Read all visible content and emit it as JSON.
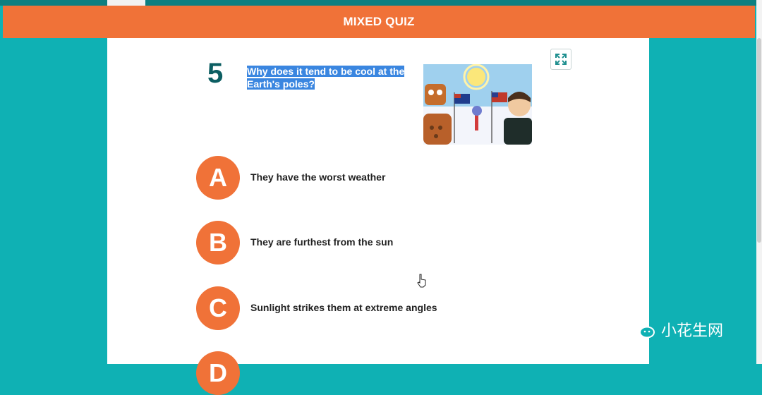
{
  "header": {
    "title": "MIXED QUIZ"
  },
  "question": {
    "number": "5",
    "text": "Why does it tend to be cool at the Earth's poles?"
  },
  "options": [
    {
      "letter": "A",
      "text": "They have the worst weather"
    },
    {
      "letter": "B",
      "text": "They are furthest from the sun"
    },
    {
      "letter": "C",
      "text": "Sunlight strikes them at extreme angles"
    },
    {
      "letter": "D",
      "text": ""
    }
  ],
  "icons": {
    "expand": "expand-icon",
    "cursor": "hand-pointer-icon",
    "watermark": "wechat-icon"
  },
  "watermark": {
    "text": "小花生网"
  },
  "colors": {
    "accent": "#f07238",
    "background": "#0fb1b4",
    "question_number": "#0c5e62",
    "selection": "#3a86e0"
  }
}
